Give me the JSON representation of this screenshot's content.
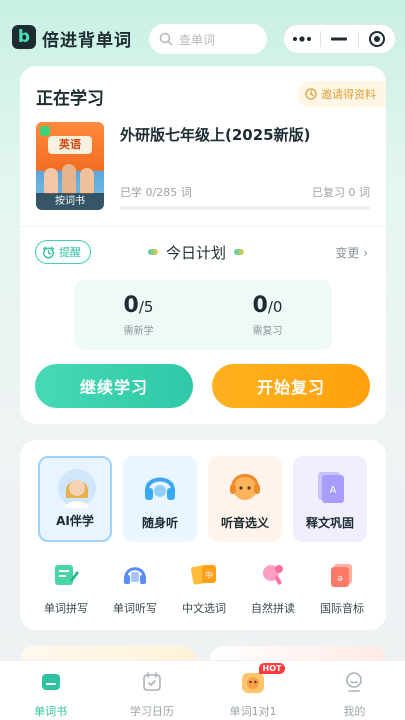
{
  "header": {
    "logo_letter": "b",
    "app_title": "倍进背单词",
    "search_placeholder": "查单词"
  },
  "learning": {
    "section_title": "正在学习",
    "invite_label": "邀请得资料",
    "book": {
      "cover_title": "英语",
      "cover_tag": "按词书",
      "name": "外研版七年级上(2025新版)",
      "learned_text": "已学 0/285 词",
      "reviewed_text": "已复习 0 词",
      "progress": 0
    }
  },
  "plan": {
    "remind_label": "提醒",
    "title": "今日计划",
    "change_label": "变更 ›",
    "new_count": "0",
    "new_total": "/5",
    "new_label": "需新学",
    "review_count": "0",
    "review_total": "/0",
    "review_label": "需复习",
    "continue_label": "继续学习",
    "review_button_label": "开始复习"
  },
  "features": [
    {
      "label": "AI伴学"
    },
    {
      "label": "随身听"
    },
    {
      "label": "听音选义"
    },
    {
      "label": "释文巩固"
    }
  ],
  "tools": [
    {
      "label": "单词拼写"
    },
    {
      "label": "单词听写"
    },
    {
      "label": "中文选词"
    },
    {
      "label": "自然拼读"
    },
    {
      "label": "国际音标"
    }
  ],
  "tabs": [
    {
      "label": "单词书"
    },
    {
      "label": "学习日历"
    },
    {
      "label": "单词1对1",
      "badge": "HOT"
    },
    {
      "label": "我的"
    }
  ],
  "colors": {
    "accent": "#2ec2a0",
    "review": "#ffa10d",
    "text": "#1d2b33"
  }
}
